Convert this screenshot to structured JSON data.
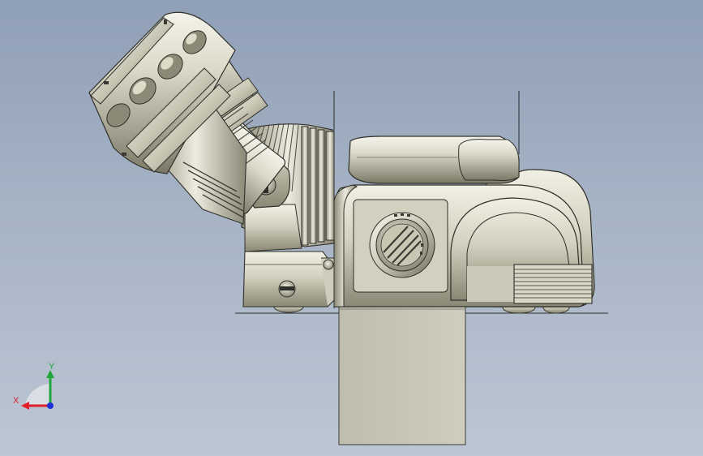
{
  "viewport": {
    "background_top": "#8f9fb6",
    "background_bottom": "#bcc6d4",
    "model_description_icon": "cad-part-icon"
  },
  "triad": {
    "x_label": "X",
    "y_label": "Y",
    "x_color": "#e0202a",
    "y_color": "#1fa63a",
    "z_color": "#1d2fd6"
  },
  "colors": {
    "metal_light": "#e4e3d2",
    "metal_mid": "#bdbba6",
    "metal_dark": "#6f6d5d",
    "outline": "#2f2f2a",
    "block_fill": "#c9c8b8"
  }
}
